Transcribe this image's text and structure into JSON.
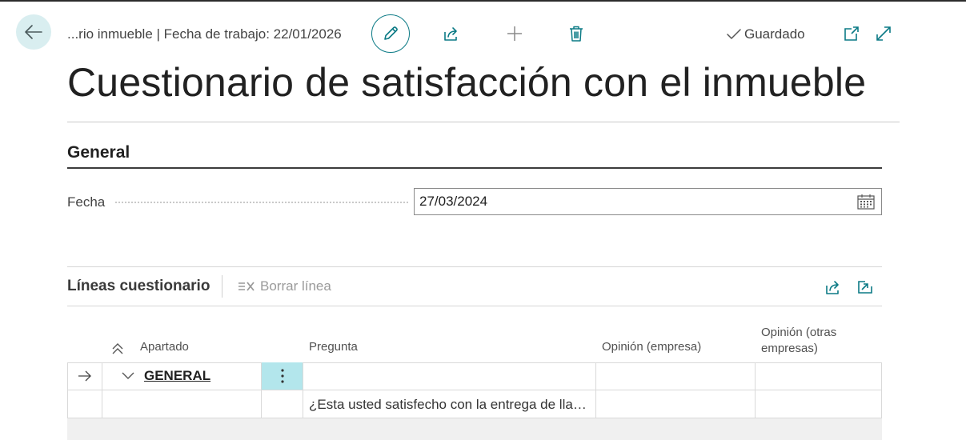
{
  "header": {
    "breadcrumb": "...rio inmueble | Fecha de trabajo: 22/01/2026",
    "saved_label": "Guardado",
    "icons": [
      "arrow-left-icon",
      "pencil-icon",
      "share-icon",
      "plus-icon",
      "trash-icon",
      "checkmark-icon",
      "open-new-window-icon",
      "expand-icon"
    ]
  },
  "page": {
    "title": "Cuestionario de satisfacción con el inmueble"
  },
  "general": {
    "section_title": "General",
    "fecha_label": "Fecha",
    "fecha_value": "27/03/2024"
  },
  "lines": {
    "title": "Líneas cuestionario",
    "delete_label": "Borrar línea",
    "columns": {
      "apartado": "Apartado",
      "pregunta": "Pregunta",
      "opinion_empresa": "Opinión (empresa)",
      "opinion_otras": "Opinión (otras empresas)"
    },
    "rows": [
      {
        "apartado": "GENERAL",
        "pregunta": "",
        "opinion_empresa": "",
        "opinion_otras": ""
      },
      {
        "apartado": "",
        "pregunta": "¿Esta usted satisfecho con la entrega de llav...",
        "opinion_empresa": "",
        "opinion_otras": ""
      }
    ]
  },
  "colors": {
    "accent": "#0b7a85",
    "back_button_bg": "#d9eef0",
    "selected_cell_bg": "#b3e6ec"
  }
}
